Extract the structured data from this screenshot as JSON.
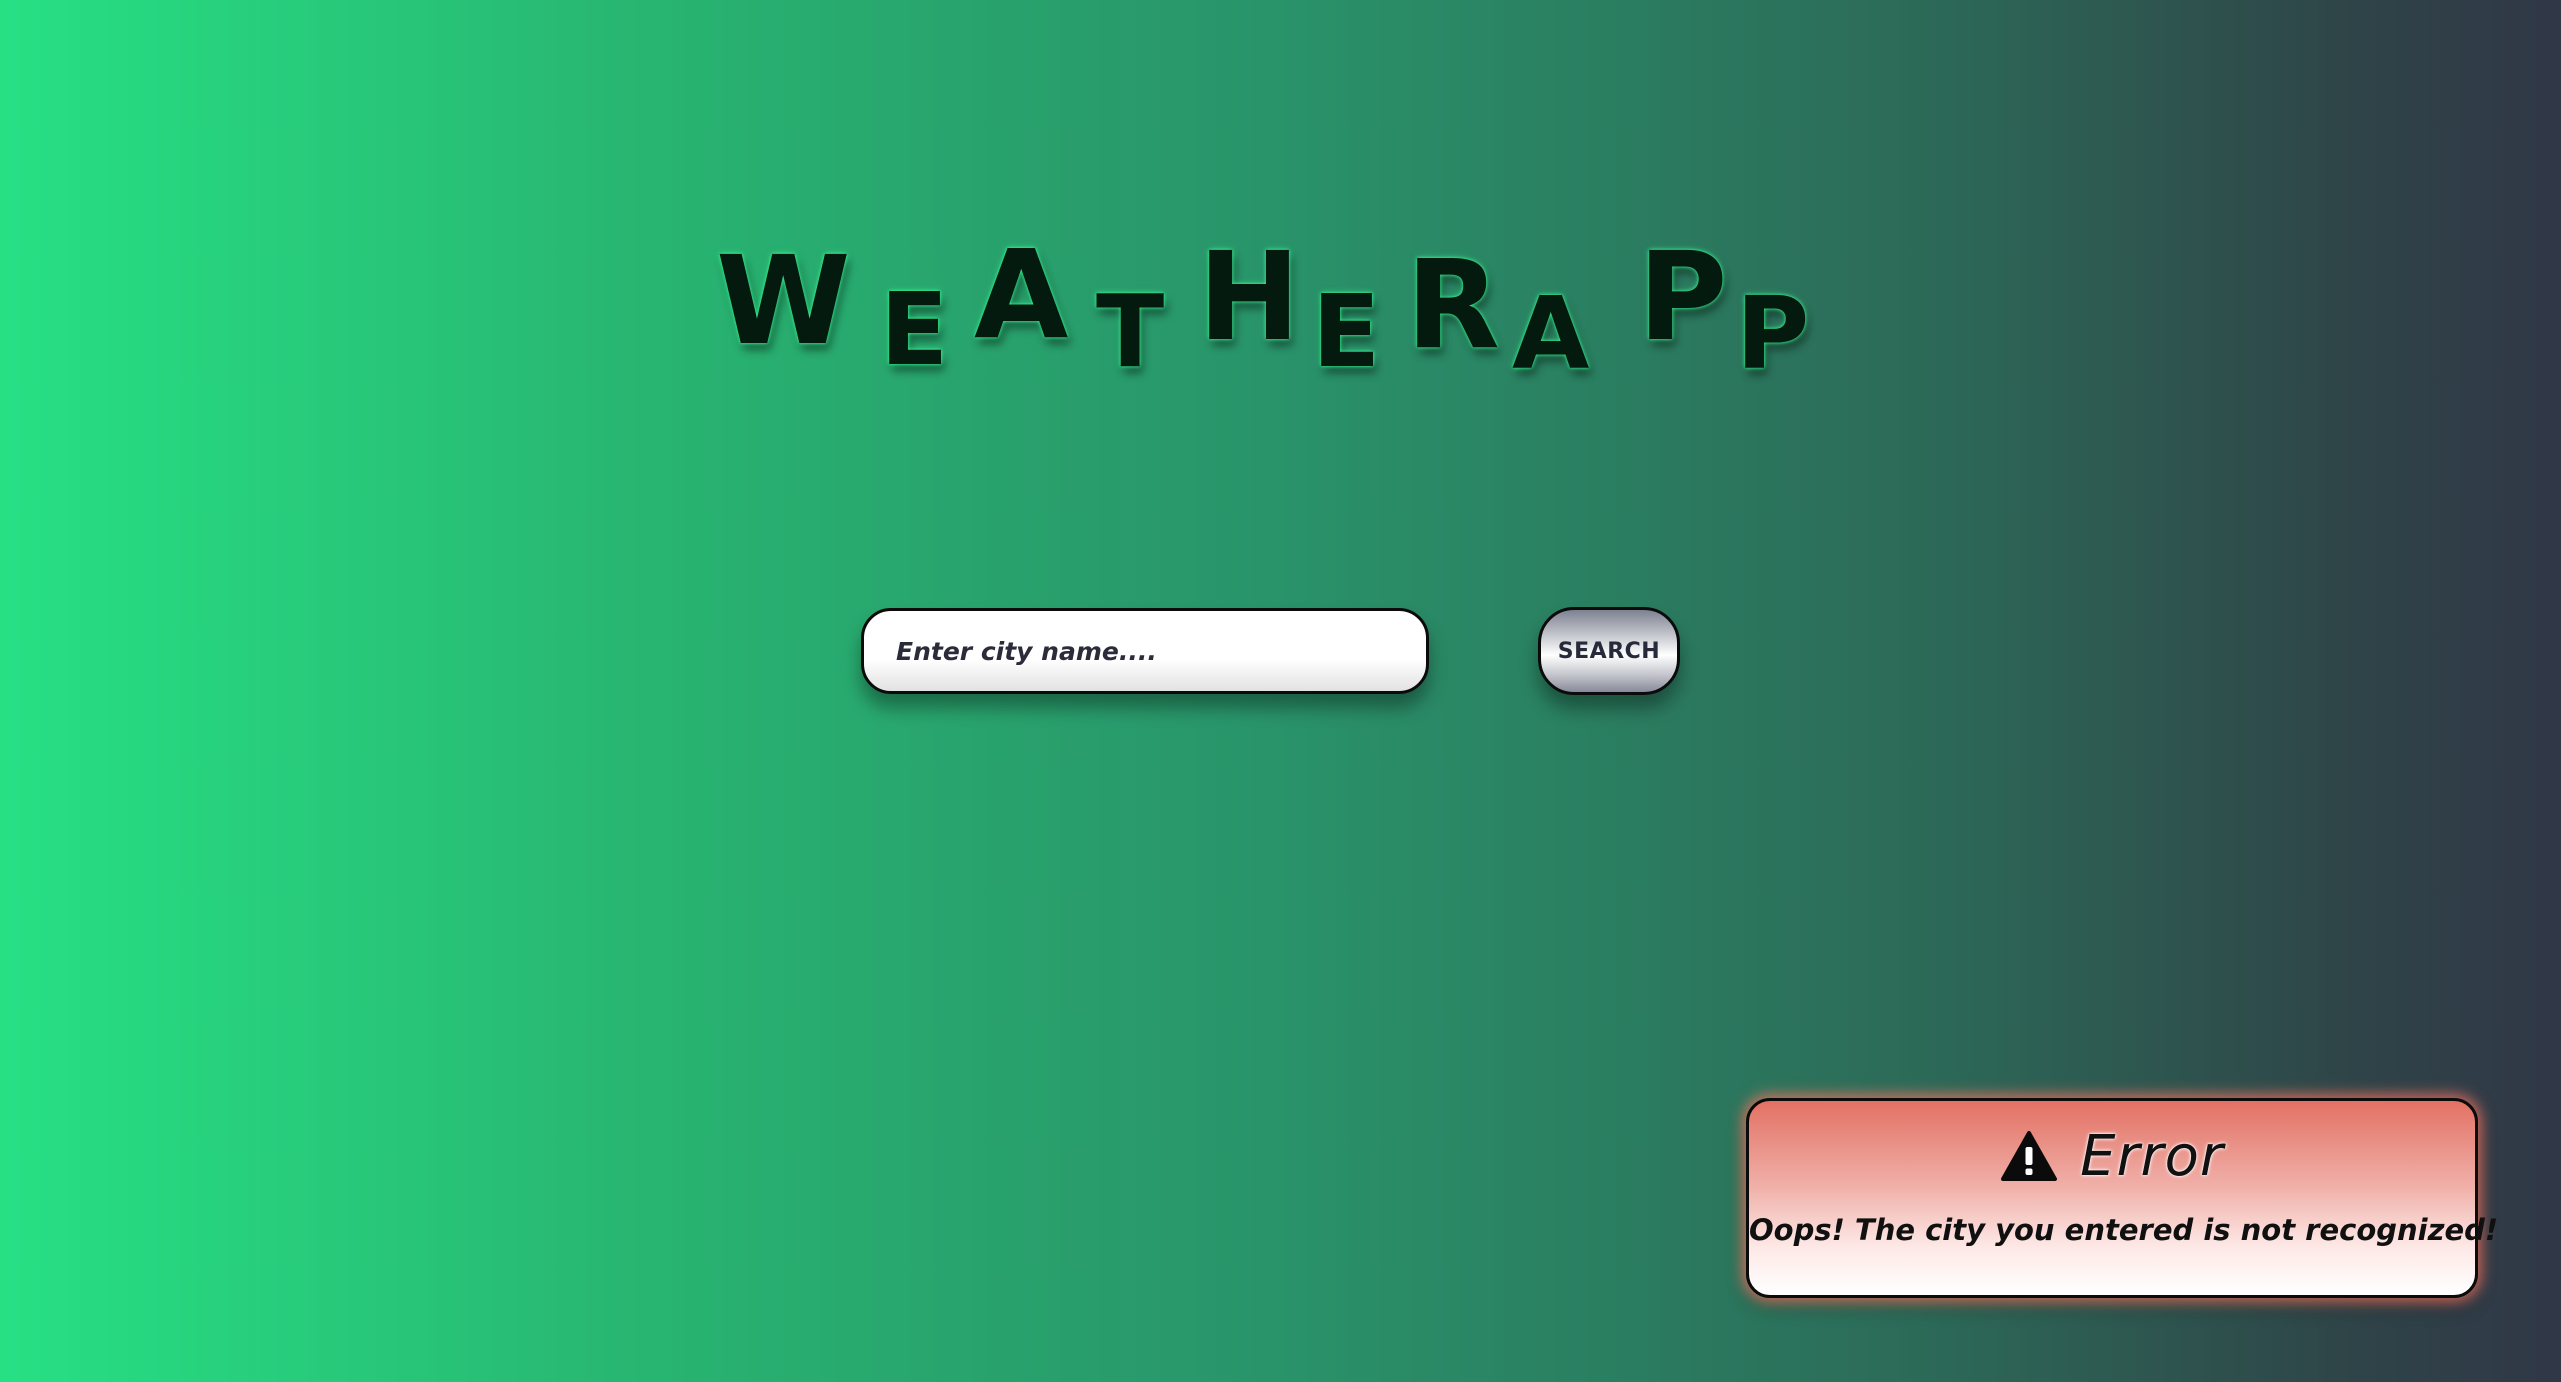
{
  "app": {
    "title_letters": [
      "W",
      "E",
      "A",
      "T",
      "H",
      "E",
      "R",
      "A",
      "P",
      "P"
    ]
  },
  "search": {
    "placeholder": "Enter city name....",
    "value": "",
    "button_label": "SEARCH"
  },
  "error": {
    "icon": "warning-triangle-icon",
    "title": "Error",
    "message": "Oops! The city you entered is not recognized!"
  },
  "colors": {
    "background_start": "#27e084",
    "background_end": "#303747",
    "title_glow": "#37ff9a",
    "error_accent": "#e37164"
  }
}
